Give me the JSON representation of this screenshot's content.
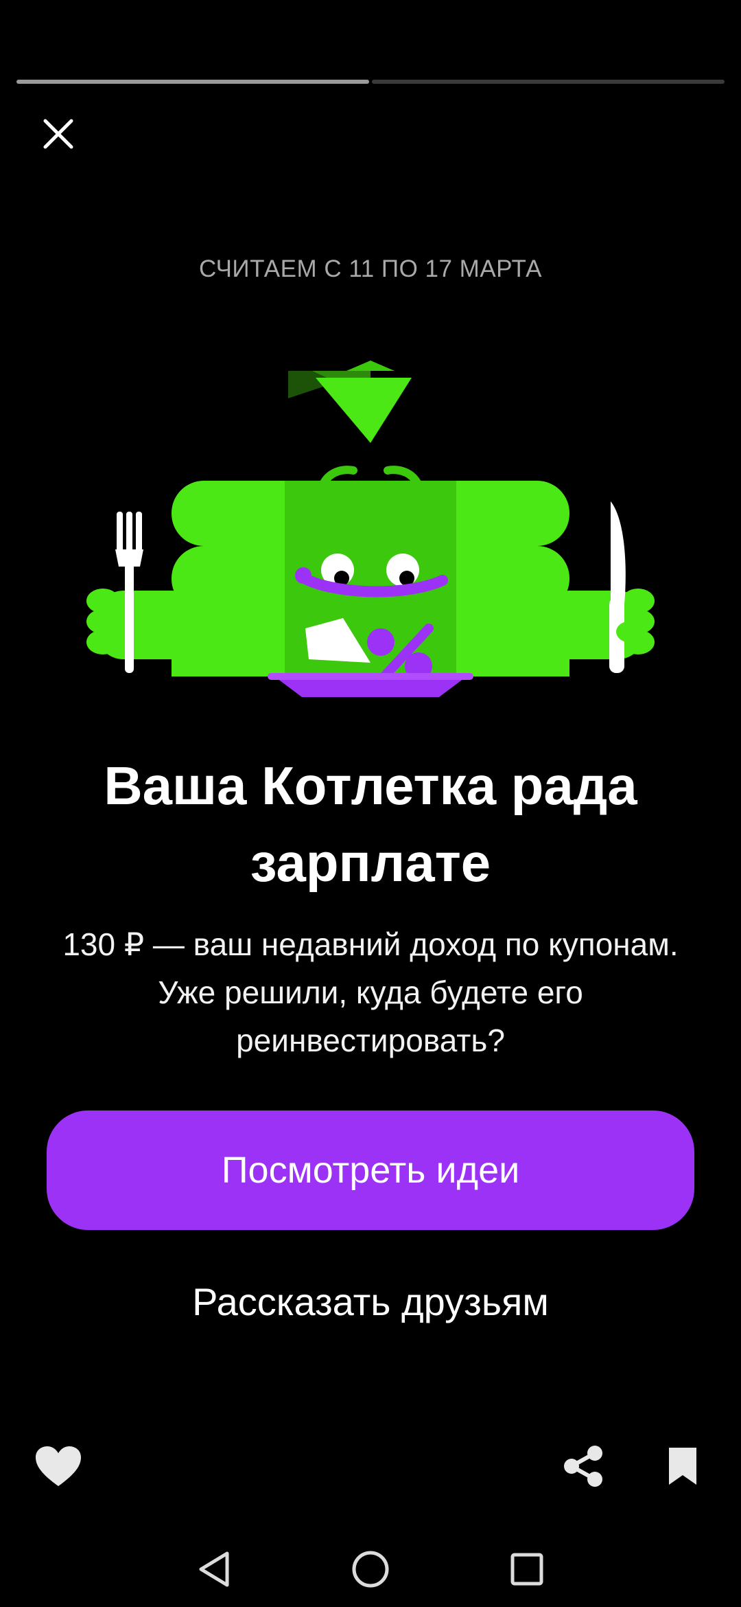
{
  "story": {
    "progress": {
      "segments": 2,
      "active_index": 0,
      "filled_fraction": 0.5
    },
    "period_label": "СЧИТАЕМ С 11 ПО 17 МАРТА",
    "headline": "Ваша Котлетка рада зарплате",
    "body": "130 ₽ — ваш недавний доход по купонам. Уже решили, куда будете его реинвестировать?",
    "primary_button": "Посмотреть идеи",
    "secondary_button": "Рассказать друзьям"
  },
  "icons": {
    "close": "close-icon",
    "like": "heart-icon",
    "share": "share-icon",
    "bookmark": "bookmark-icon",
    "nav_back": "back-triangle-icon",
    "nav_home": "home-circle-icon",
    "nav_recents": "recents-square-icon"
  },
  "colors": {
    "background": "#000000",
    "accent_purple": "#9b32f5",
    "mascot_green": "#4ce816",
    "mascot_green_dark": "#3cc80c",
    "text_muted": "#a9a9a9"
  }
}
